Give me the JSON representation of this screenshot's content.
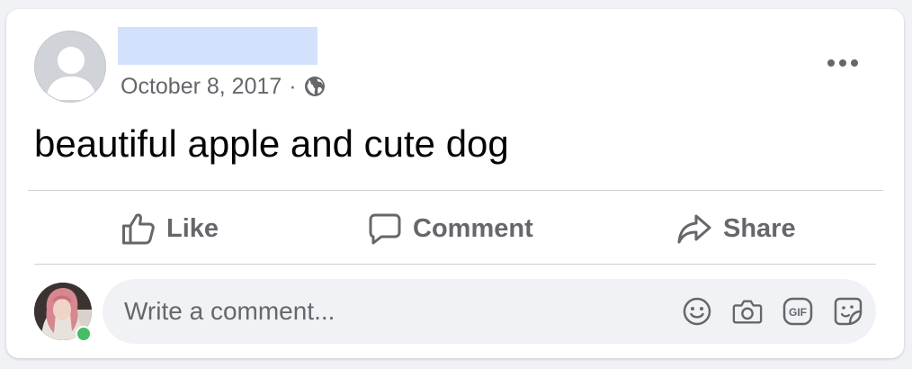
{
  "post": {
    "date": "October 8, 2017",
    "separator": "·",
    "privacy_icon": "globe-icon",
    "text": "beautiful apple and cute dog"
  },
  "actions": {
    "like_label": "Like",
    "comment_label": "Comment",
    "share_label": "Share"
  },
  "comment_composer": {
    "placeholder": "Write a comment...",
    "gif_label": "GIF",
    "icons": [
      "emoji-icon",
      "camera-icon",
      "gif-icon",
      "sticker-icon"
    ]
  },
  "colors": {
    "secondary_text": "#65676b",
    "online": "#45bd62",
    "redaction": "#d3e1fd"
  }
}
